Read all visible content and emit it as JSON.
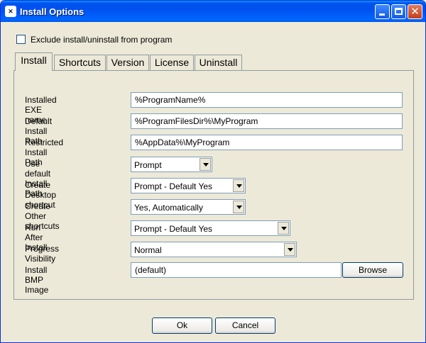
{
  "window": {
    "title": "Install Options"
  },
  "titlebar_icons": {
    "app": "installer-app-icon",
    "minimize": "minimize-icon",
    "maximize": "maximize-icon",
    "close": "close-icon"
  },
  "exclude": {
    "label": "Exclude install/uninstall from program",
    "checked": false
  },
  "tabs": [
    "Install",
    "Shortcuts",
    "Version",
    "License",
    "Uninstall"
  ],
  "fields": {
    "exe_name": {
      "label": "Installed EXE name",
      "value": "%ProgramName%"
    },
    "default_path": {
      "label": "Default Install Path",
      "value": "%ProgramFilesDir%\\MyProgram"
    },
    "restricted_path": {
      "label": "Restricted Install Path",
      "value": "%AppData%\\MyProgram"
    },
    "use_default": {
      "label": "Use default Install Path",
      "value": "Prompt"
    },
    "desktop_shortcut": {
      "label": "Create Desktop shortcut",
      "value": "Prompt - Default Yes"
    },
    "other_shortcuts": {
      "label": "Create Other shortcuts",
      "value": "Yes, Automatically"
    },
    "run_after": {
      "label": "Run After Install",
      "value": "Prompt - Default Yes"
    },
    "progress": {
      "label": "Progress Visibility",
      "value": "Normal"
    },
    "bmp_image": {
      "label": "Install BMP Image",
      "value": "(default)",
      "browse": "Browse"
    }
  },
  "buttons": {
    "ok": "Ok",
    "cancel": "Cancel"
  }
}
